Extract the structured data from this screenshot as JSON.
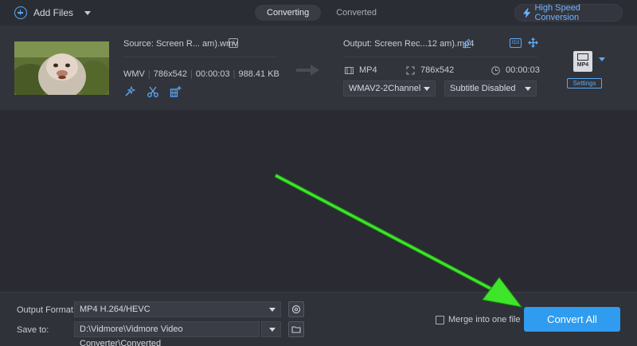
{
  "topbar": {
    "add_files": "Add Files",
    "tabs": [
      {
        "label": "Converting",
        "active": true
      },
      {
        "label": "Converted",
        "active": false
      }
    ],
    "high_speed": "High Speed Conversion"
  },
  "file": {
    "source_label": "Source: Screen R... am).wmv",
    "info_glyph": "i",
    "src_format": "WMV",
    "src_resolution": "786x542",
    "src_duration": "00:00:03",
    "src_size": "988.41 KB",
    "output_label": "Output: Screen Rec...12 am).mp4",
    "id3_label": "ID3",
    "out_format": "MP4",
    "out_resolution": "786x542",
    "out_duration": "00:00:03",
    "audio_select": "WMAV2-2Channel",
    "subtitle_select": "Subtitle Disabled",
    "format_badge": "MP4",
    "settings_label": "Settings"
  },
  "bottom": {
    "output_format_label": "Output Format:",
    "output_format_value": "MP4 H.264/HEVC",
    "save_to_label": "Save to:",
    "save_to_value": "D:\\Vidmore\\Vidmore Video Converter\\Converted",
    "merge_label": "Merge into one file",
    "convert_all": "Convert All"
  },
  "colors": {
    "accent": "#2f9cf0",
    "highlight_arrow": "#3ee52a",
    "background": "#2a2b32"
  }
}
